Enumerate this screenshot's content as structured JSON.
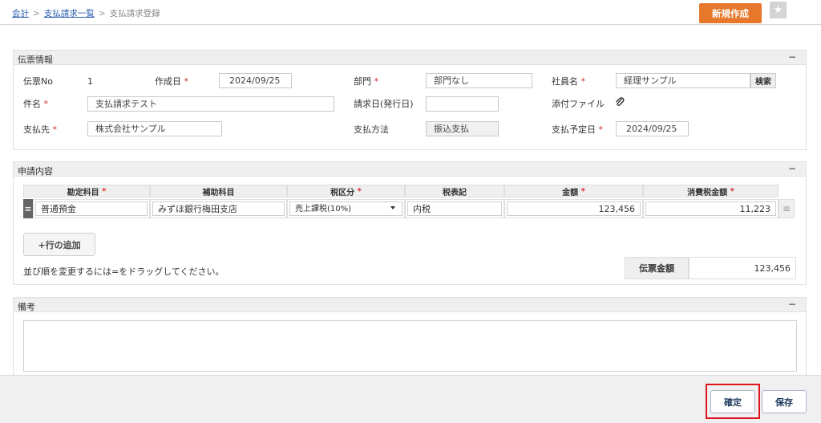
{
  "breadcrumb": {
    "items": [
      "会計",
      "支払請求一覧"
    ],
    "current": "支払請求登録",
    "sep": ">"
  },
  "header": {
    "new_button": "新規作成",
    "star_icon": "★"
  },
  "slip_info": {
    "title": "伝票情報",
    "collapse": "−",
    "slip_no_label": "伝票No",
    "slip_no": "1",
    "created_label": "作成日",
    "created_value": "2024/09/25",
    "dept_label": "部門",
    "dept_value": "部門なし",
    "employee_label": "社員名",
    "employee_value": "経理サンプル",
    "search_button": "検索",
    "subject_label": "件名",
    "subject_value": "支払請求テスト",
    "invoice_date_label": "請求日(発行日)",
    "invoice_date_value": "",
    "attachment_label": "添付ファイル",
    "payee_label": "支払先",
    "payee_value": "株式会社サンプル",
    "method_label": "支払方法",
    "method_value": "振込支払",
    "due_label": "支払予定日",
    "due_value": "2024/09/25",
    "required_mark": "*"
  },
  "application": {
    "title": "申請内容",
    "collapse": "−",
    "columns": [
      "勘定科目",
      "補助科目",
      "税区分",
      "税表記",
      "金額",
      "消費税金額"
    ],
    "rows": [
      {
        "account": "普通預金",
        "sub_account": "みずほ銀行梅田支店",
        "tax_category": "売上課税(10%)",
        "tax_notation": "内税",
        "amount": "123,456",
        "tax_amount": "11,223"
      }
    ],
    "add_row_button": "+行の追加",
    "hint": "並び順を変更するには=をドラッグしてください。",
    "total_label": "伝票金額",
    "total_value": "123,456",
    "required_mark": "*"
  },
  "remarks": {
    "title": "備考",
    "collapse": "−",
    "value": ""
  },
  "footer": {
    "confirm_button": "確定",
    "save_button": "保存"
  },
  "colors": {
    "accent": "#e7782b",
    "highlight": "#e0121b",
    "link": "#2a5db0"
  }
}
